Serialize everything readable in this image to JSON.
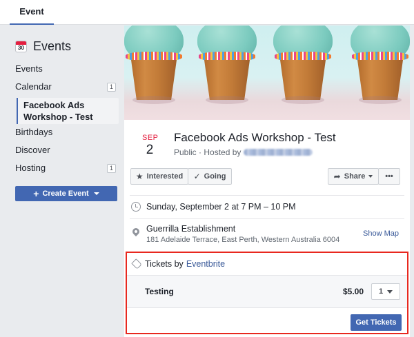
{
  "topbar": {
    "tab_label": "Event"
  },
  "sidebar": {
    "title": "Events",
    "calendar_icon_number": "30",
    "items": [
      {
        "label": "Events",
        "count": ""
      },
      {
        "label": "Calendar",
        "count": "1"
      },
      {
        "label": "Facebook Ads Workshop - Test",
        "count": ""
      },
      {
        "label": "Birthdays",
        "count": ""
      },
      {
        "label": "Discover",
        "count": ""
      },
      {
        "label": "Hosting",
        "count": "1"
      }
    ],
    "create_button": "Create Event"
  },
  "event": {
    "month": "SEP",
    "day": "2",
    "title": "Facebook Ads Workshop - Test",
    "subtitle": "Public · Hosted by",
    "buttons": {
      "interested": "Interested",
      "going": "Going",
      "share": "Share",
      "more": "•••"
    },
    "date_time": "Sunday, September 2 at 7 PM – 10 PM",
    "venue": "Guerrilla Establishment",
    "address": "181 Adelaide Terrace, East Perth, Western Australia 6004",
    "show_map": "Show Map"
  },
  "tickets": {
    "prefix": "Tickets by",
    "provider": "Eventbrite",
    "ticket_name": "Testing",
    "price": "$5.00",
    "quantity": "1",
    "get_button": "Get Tickets"
  },
  "colors": {
    "accent": "#4267b2",
    "highlight_border": "#e8281f",
    "date_red": "#e41e3f",
    "link": "#385898"
  }
}
